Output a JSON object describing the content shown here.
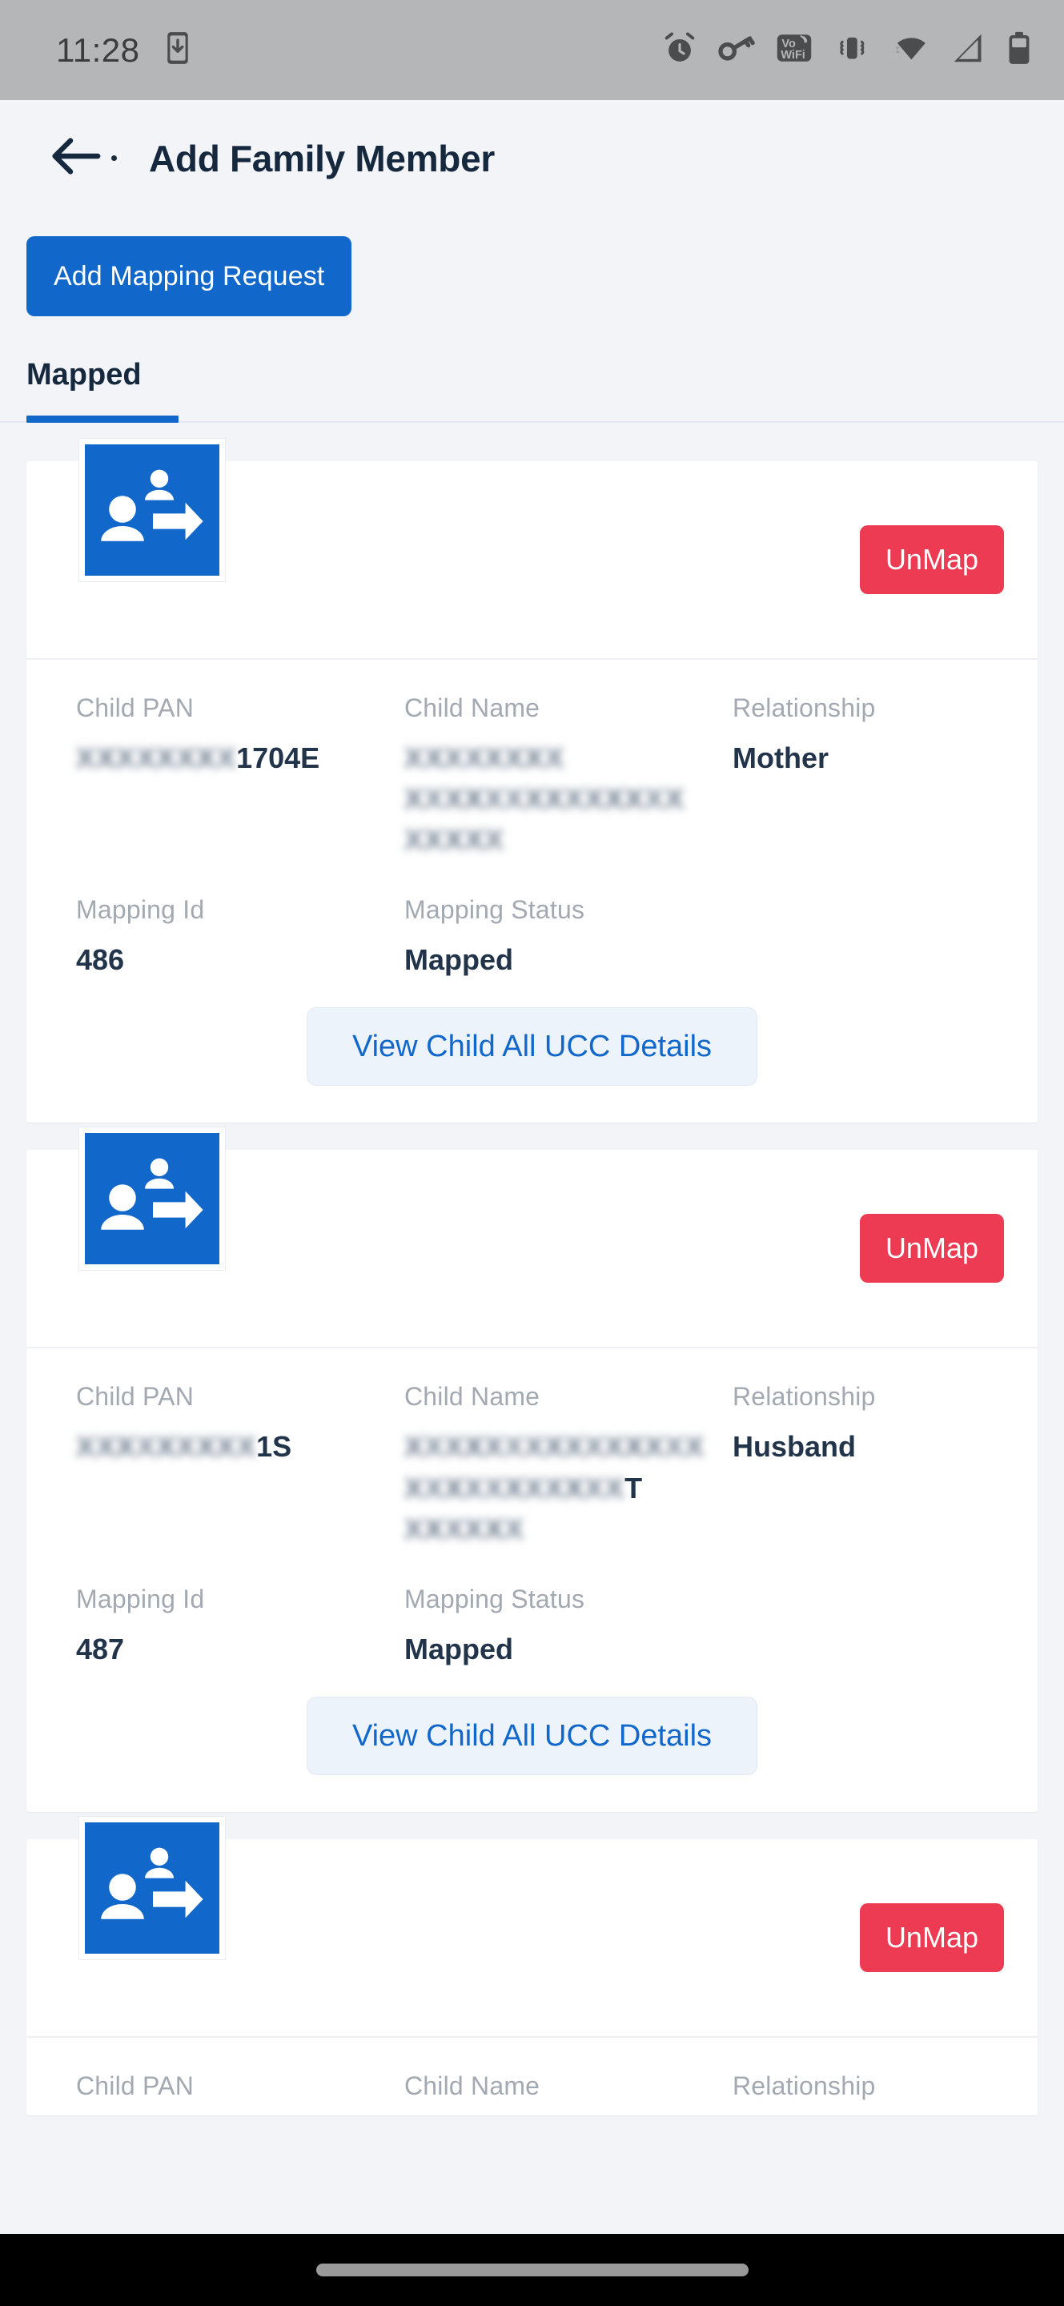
{
  "status_bar": {
    "time": "11:28",
    "icons": [
      "phone-download-icon",
      "alarm-clock-icon",
      "vpn-key-icon",
      "vowifi-icon",
      "vibrate-icon",
      "wifi-icon",
      "cellular-signal-icon",
      "battery-icon"
    ]
  },
  "header": {
    "back_icon": "arrow-left-icon",
    "title": "Add Family Member"
  },
  "toolbar": {
    "add_mapping_label": "Add Mapping Request"
  },
  "tabs": [
    {
      "label": "Mapped",
      "active": true
    }
  ],
  "labels": {
    "child_pan": "Child PAN",
    "child_name": "Child Name",
    "relationship": "Relationship",
    "mapping_id": "Mapping Id",
    "mapping_status": "Mapping Status"
  },
  "buttons": {
    "unmap": "UnMap",
    "view_ucc": "View Child All UCC Details"
  },
  "colors": {
    "primary_blue": "#1268ca",
    "danger_red": "#ec3b52",
    "page_bg": "#f2f4f8",
    "card_bg": "#ffffff",
    "label_gray": "#a3a9b1",
    "value_navy": "#223449",
    "status_bar_gray": "#b4b6b8",
    "nav_bar_black": "#000000"
  },
  "cards": [
    {
      "icon": "share-people-icon",
      "unmap_label": "UnMap",
      "child_pan_redacted": "XXXXXXXX",
      "child_pan_visible": "1704E",
      "child_name_lines": [
        {
          "redacted": "XXXXXXXX",
          "visible": ""
        },
        {
          "redacted": "XXXXXXXXXXXXXX",
          "visible": ""
        },
        {
          "redacted": "XXXXX",
          "visible": ""
        }
      ],
      "relationship": "Mother",
      "mapping_id": "486",
      "mapping_status": "Mapped",
      "view_ucc_label": "View Child All UCC Details"
    },
    {
      "icon": "share-people-icon",
      "unmap_label": "UnMap",
      "child_pan_redacted": "XXXXXXXXX",
      "child_pan_visible": "1S",
      "child_name_lines": [
        {
          "redacted": "XXXXXXXXXXXXXXX",
          "visible": ""
        },
        {
          "redacted": "XXXXXXXXXXX",
          "visible": "T"
        },
        {
          "redacted": "XXXXXX",
          "visible": ""
        }
      ],
      "relationship": "Husband",
      "mapping_id": "487",
      "mapping_status": "Mapped",
      "view_ucc_label": "View Child All UCC Details"
    },
    {
      "icon": "share-people-icon",
      "unmap_label": "UnMap",
      "child_pan_redacted": "",
      "child_pan_visible": "",
      "child_name_lines": [],
      "relationship": "",
      "mapping_id": "",
      "mapping_status": "",
      "view_ucc_label": ""
    }
  ]
}
